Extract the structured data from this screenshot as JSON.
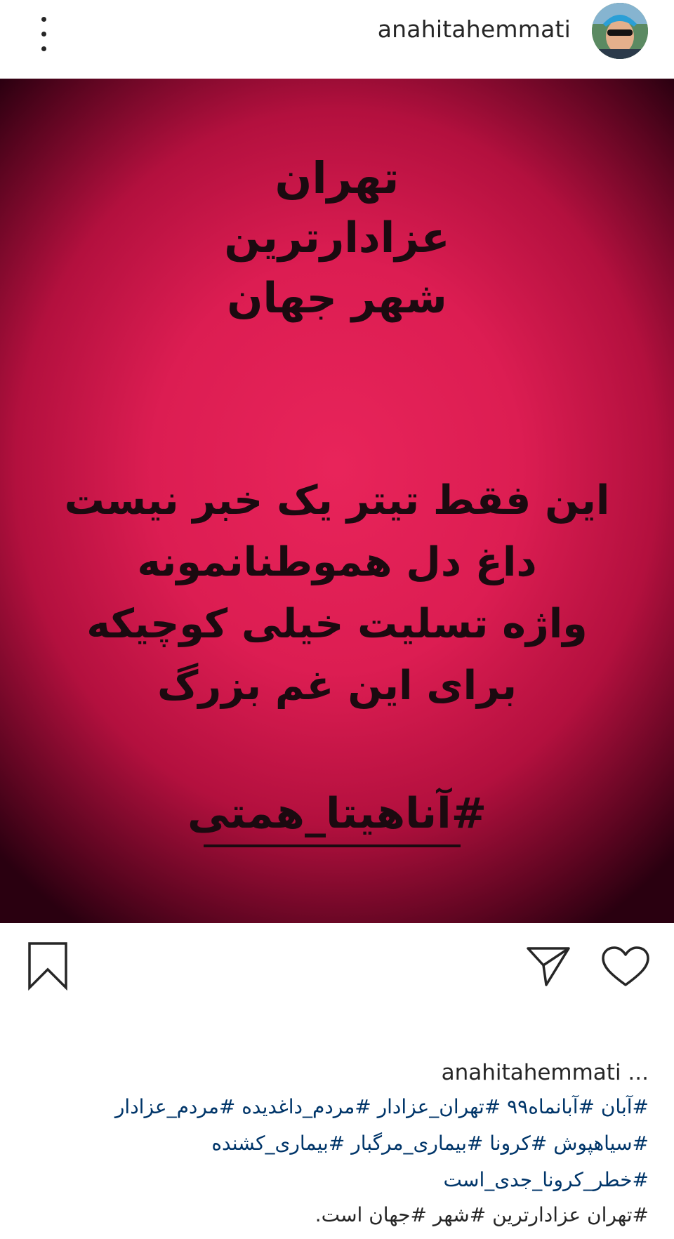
{
  "header": {
    "username": "anahitahemmati",
    "avatar_icon": "avatar-icon",
    "more_icon": "more-vertical-icon"
  },
  "post": {
    "image_lines": [
      "تهران",
      "عزادارترین",
      "شهر جهان",
      "این فقط تیتر یک خبر نیست",
      "داغ دل هموطنانمونه",
      "واژه تسلیت خیلی کوچیکه",
      "برای این غم بزرگ",
      "#آناهیتا_همتی"
    ],
    "background_color": "#e02257",
    "text_color": "#1b0a10"
  },
  "actions": {
    "like_icon": "heart-icon",
    "share_icon": "paper-plane-icon",
    "save_icon": "bookmark-icon"
  },
  "caption": {
    "user_line": "anahitahemmati ...",
    "hashtag_lines": [
      "#آبان #آبانماه۹۹ #تهران_عزادار #مردم_داغدیده #مردم_عزادار",
      "#سیاهپوش #کرونا #بیماری_مرگبار #بیماری_کشنده",
      "#خطر_کرونا_جدی_است"
    ],
    "text_line": "#تهران عزادارترین #شهر #جهان است.",
    "hashtag_color": "#003569"
  }
}
